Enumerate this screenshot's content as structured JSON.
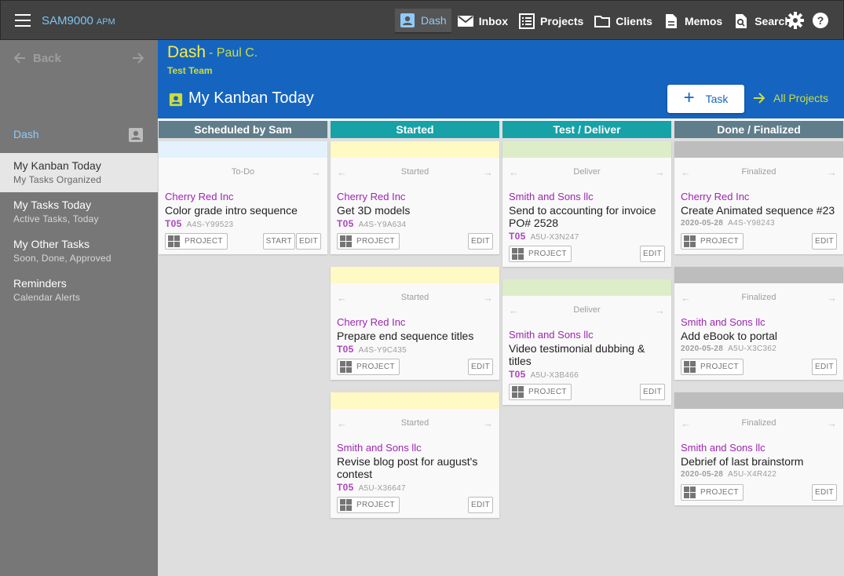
{
  "app": {
    "name": "SAM9000",
    "suffix": "APM"
  },
  "nav": {
    "items": [
      {
        "label": "Dash",
        "icon": "person-badge-icon",
        "active": true
      },
      {
        "label": "Inbox",
        "icon": "mail-icon"
      },
      {
        "label": "Projects",
        "icon": "list-icon"
      },
      {
        "label": "Clients",
        "icon": "folder-icon"
      },
      {
        "label": "Memos",
        "icon": "document-icon"
      },
      {
        "label": "Search",
        "icon": "search-icon"
      }
    ]
  },
  "sidebar": {
    "back_label": "Back",
    "section_label": "Dash",
    "items": [
      {
        "title": "My Kanban Today",
        "subtitle": "My Tasks Organized",
        "active": true
      },
      {
        "title": "My Tasks Today",
        "subtitle": "Active Tasks, Today"
      },
      {
        "title": "My Other Tasks",
        "subtitle": "Soon, Done, Approved"
      },
      {
        "title": "Reminders",
        "subtitle": "Calendar Alerts"
      }
    ]
  },
  "header": {
    "title": "Dash",
    "user": "- Paul C.",
    "team": "Test Team",
    "kanban_title": "My Kanban Today",
    "task_button": "Task",
    "all_projects": "All Projects"
  },
  "buttons": {
    "project": "PROJECT",
    "start": "START",
    "edit": "EDIT"
  },
  "columns": [
    {
      "title": "Scheduled by Sam",
      "head_color": "#607d8b",
      "band_color": "#e3f2fd",
      "cards": [
        {
          "status": "To-Do",
          "client": "Cherry Red Inc",
          "title": "Color grade intro sequence",
          "code": "T05",
          "date": "",
          "id": "A4S-Y99523",
          "start": true
        }
      ]
    },
    {
      "title": "Started",
      "head_color": "#17a2a8",
      "band_color": "#fff9c4",
      "cards": [
        {
          "status": "Started",
          "client": "Cherry Red Inc",
          "title": "Get 3D models",
          "code": "T05",
          "date": "",
          "id": "A4S-Y9A634"
        },
        {
          "status": "Started",
          "client": "Cherry Red Inc",
          "title": "Prepare end sequence titles",
          "code": "T05",
          "date": "",
          "id": "A4S-Y9C435"
        },
        {
          "status": "Started",
          "client": "Smith and Sons llc",
          "title": "Revise blog post for august's contest",
          "code": "T05",
          "date": "",
          "id": "A5U-X36647"
        }
      ]
    },
    {
      "title": "Test / Deliver",
      "head_color": "#17a2a8",
      "band_color": "#dcedc8",
      "cards": [
        {
          "status": "Deliver",
          "client": "Smith and Sons llc",
          "title": "Send to accounting for invoice PO# 2528",
          "code": "T05",
          "date": "",
          "id": "A5U-X3N247"
        },
        {
          "status": "Deliver",
          "client": "Smith and Sons llc",
          "title": "Video testimonial dubbing & titles",
          "code": "T05",
          "date": "",
          "id": "A5U-X3B466"
        }
      ]
    },
    {
      "title": "Done / Finalized",
      "head_color": "#607d8b",
      "band_color": "#bdbdbd",
      "cards": [
        {
          "status": "Finalized",
          "client": "Cherry Red Inc",
          "title": "Create Animated sequence #23",
          "code": "",
          "date": "2020-05-28",
          "id": "A4S-Y98243"
        },
        {
          "status": "Finalized",
          "client": "Smith and Sons llc",
          "title": "Add eBook to portal",
          "code": "",
          "date": "2020-05-28",
          "id": "A5U-X3C362"
        },
        {
          "status": "Finalized",
          "client": "Smith and Sons llc",
          "title": "Debrief of last brainstorm",
          "code": "",
          "date": "2020-05-28",
          "id": "A5U-X4R422"
        }
      ]
    }
  ]
}
